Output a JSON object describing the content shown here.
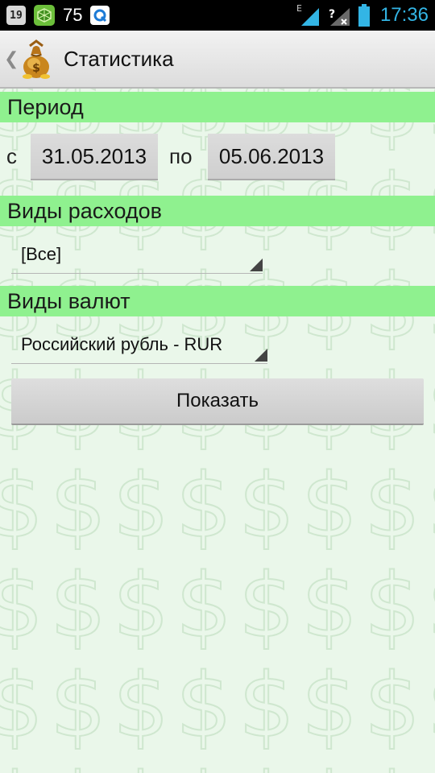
{
  "status_bar": {
    "notification_badge": "19",
    "battery_number": "75",
    "network_label": "E",
    "time": "17:36"
  },
  "action_bar": {
    "title": "Статистика"
  },
  "period": {
    "header": "Период",
    "from_label": "с",
    "from_date": "31.05.2013",
    "to_label": "по",
    "to_date": "05.06.2013"
  },
  "expense_types": {
    "header": "Виды расходов",
    "selected": "[Все]"
  },
  "currency_types": {
    "header": "Виды валют",
    "selected": "Российский рубль - RUR"
  },
  "show_button": {
    "label": "Показать"
  },
  "colors": {
    "section_header_bg": "#8ff18f",
    "content_bg": "#eaf7ea",
    "clock": "#33b5e5",
    "signal": "#33b5e5"
  },
  "icons": {
    "back": "chevron-left-icon",
    "logo": "money-bag-icon",
    "dropdown": "dropdown-triangle-icon"
  }
}
